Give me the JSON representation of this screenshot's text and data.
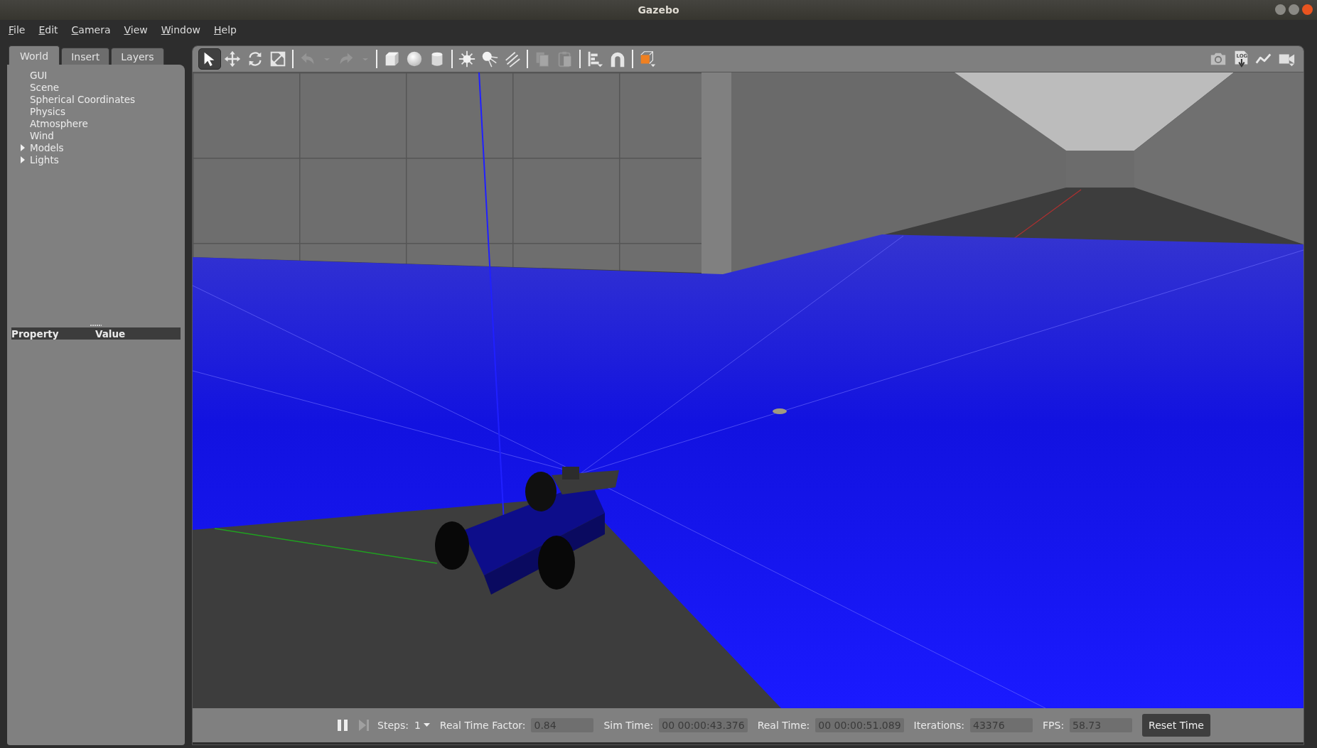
{
  "window": {
    "title": "Gazebo"
  },
  "menu": [
    "File",
    "Edit",
    "Camera",
    "View",
    "Window",
    "Help"
  ],
  "tabs": [
    {
      "label": "World",
      "selected": true
    },
    {
      "label": "Insert",
      "selected": false
    },
    {
      "label": "Layers",
      "selected": false
    }
  ],
  "world_tree": [
    {
      "label": "GUI",
      "kind": "leaf"
    },
    {
      "label": "Scene",
      "kind": "leaf"
    },
    {
      "label": "Spherical Coordinates",
      "kind": "leaf"
    },
    {
      "label": "Physics",
      "kind": "leaf"
    },
    {
      "label": "Atmosphere",
      "kind": "leaf"
    },
    {
      "label": "Wind",
      "kind": "leaf"
    },
    {
      "label": "Models",
      "kind": "branch",
      "expanded": false
    },
    {
      "label": "Lights",
      "kind": "branch",
      "expanded": false
    }
  ],
  "property_table": {
    "columns": [
      "Property",
      "Value"
    ]
  },
  "toolbar": {
    "tools": [
      {
        "kind": "select",
        "selected": true,
        "disabled": false
      },
      {
        "kind": "translate",
        "selected": false,
        "disabled": false
      },
      {
        "kind": "rotate",
        "selected": false,
        "disabled": false
      },
      {
        "kind": "scale",
        "selected": false,
        "disabled": false
      },
      {
        "kind": "separator"
      },
      {
        "kind": "undo",
        "selected": false,
        "disabled": true
      },
      {
        "kind": "dropdown",
        "selected": false,
        "disabled": true
      },
      {
        "kind": "redo",
        "selected": false,
        "disabled": true
      },
      {
        "kind": "dropdown",
        "selected": false,
        "disabled": true
      },
      {
        "kind": "separator"
      },
      {
        "kind": "box",
        "selected": false,
        "disabled": false
      },
      {
        "kind": "sphere",
        "selected": false,
        "disabled": false
      },
      {
        "kind": "cylinder",
        "selected": false,
        "disabled": false
      },
      {
        "kind": "separator"
      },
      {
        "kind": "point_light",
        "selected": false,
        "disabled": false
      },
      {
        "kind": "spot_light",
        "selected": false,
        "disabled": false
      },
      {
        "kind": "directional_light",
        "selected": false,
        "disabled": false
      },
      {
        "kind": "separator"
      },
      {
        "kind": "copy",
        "selected": false,
        "disabled": true
      },
      {
        "kind": "paste",
        "selected": false,
        "disabled": true
      },
      {
        "kind": "separator"
      },
      {
        "kind": "align",
        "selected": false,
        "disabled": false
      },
      {
        "kind": "snap",
        "selected": false,
        "disabled": false
      },
      {
        "kind": "separator"
      },
      {
        "kind": "view_angle",
        "selected": false,
        "disabled": false
      }
    ],
    "right_tools": [
      {
        "kind": "screenshot"
      },
      {
        "kind": "log",
        "label": "LOG"
      },
      {
        "kind": "plot"
      },
      {
        "kind": "record"
      }
    ]
  },
  "status_bar": {
    "paused": false,
    "step_disabled": true,
    "steps": {
      "label": "Steps:",
      "value": "1"
    },
    "fields": [
      {
        "label": "Real Time Factor:",
        "value": "0.84"
      },
      {
        "label": "Sim Time:",
        "value": "00 00:00:43.376"
      },
      {
        "label": "Real Time:",
        "value": "00 00:00:51.089"
      },
      {
        "label": "Iterations:",
        "value": "43376"
      },
      {
        "label": "FPS:",
        "value": "58.73"
      }
    ],
    "reset_button": "Reset Time"
  }
}
